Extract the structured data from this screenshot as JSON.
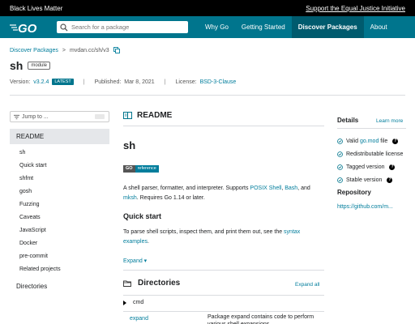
{
  "banner": {
    "left": "Black Lives Matter",
    "right": "Support the Equal Justice Initiative"
  },
  "header": {
    "search_placeholder": "Search for a package",
    "nav": [
      "Why Go",
      "Getting Started",
      "Discover Packages",
      "About"
    ]
  },
  "breadcrumb": {
    "root": "Discover Packages",
    "sep": ">",
    "path": "mvdan.cc/sh/v3"
  },
  "package": {
    "title": "sh",
    "badge": "module",
    "version_label": "Version:",
    "version": "v3.2.4",
    "latest": "LATEST",
    "published_label": "Published:",
    "published": "Mar 8, 2021",
    "license_label": "License:",
    "license": "BSD-3-Clause"
  },
  "sidebar": {
    "jump": "Jump to ...",
    "readme": "README",
    "items": [
      "sh",
      "Quick start",
      "shfmt",
      "gosh",
      "Fuzzing",
      "Caveats",
      "JavaScript",
      "Docker",
      "pre-commit",
      "Related projects"
    ],
    "directories": "Directories"
  },
  "readme": {
    "title": "README",
    "heading": "sh",
    "badge_go": "GO",
    "badge_ref": "reference",
    "desc_1": "A shell parser, formatter, and interpreter. Supports ",
    "desc_posix": "POSIX Shell",
    "desc_2": ", ",
    "desc_bash": "Bash",
    "desc_3": ", and ",
    "desc_mksh": "mksh",
    "desc_4": ". Requires Go 1.14 or later.",
    "qs_heading": "Quick start",
    "qs_1": "To parse shell scripts, inspect them, and print them out, see the ",
    "qs_link": "syntax examples",
    "qs_2": ".",
    "expand": "Expand ▾"
  },
  "directories": {
    "title": "Directories",
    "expand_all": "Expand all",
    "cmd": "cmd",
    "expand_name": "expand",
    "expand_desc": "Package expand contains code to perform various shell expansions."
  },
  "details": {
    "title": "Details",
    "learn_more": "Learn more",
    "valid_1": "Valid ",
    "valid_link": "go.mod",
    "valid_2": " file",
    "redistributable": "Redistributable license",
    "tagged": "Tagged version",
    "stable": "Stable version",
    "repo_title": "Repository",
    "repo_link": "https://github.com/m..."
  },
  "colors": {
    "header": "#00758d",
    "link": "#007d9c",
    "banner": "#000000"
  }
}
